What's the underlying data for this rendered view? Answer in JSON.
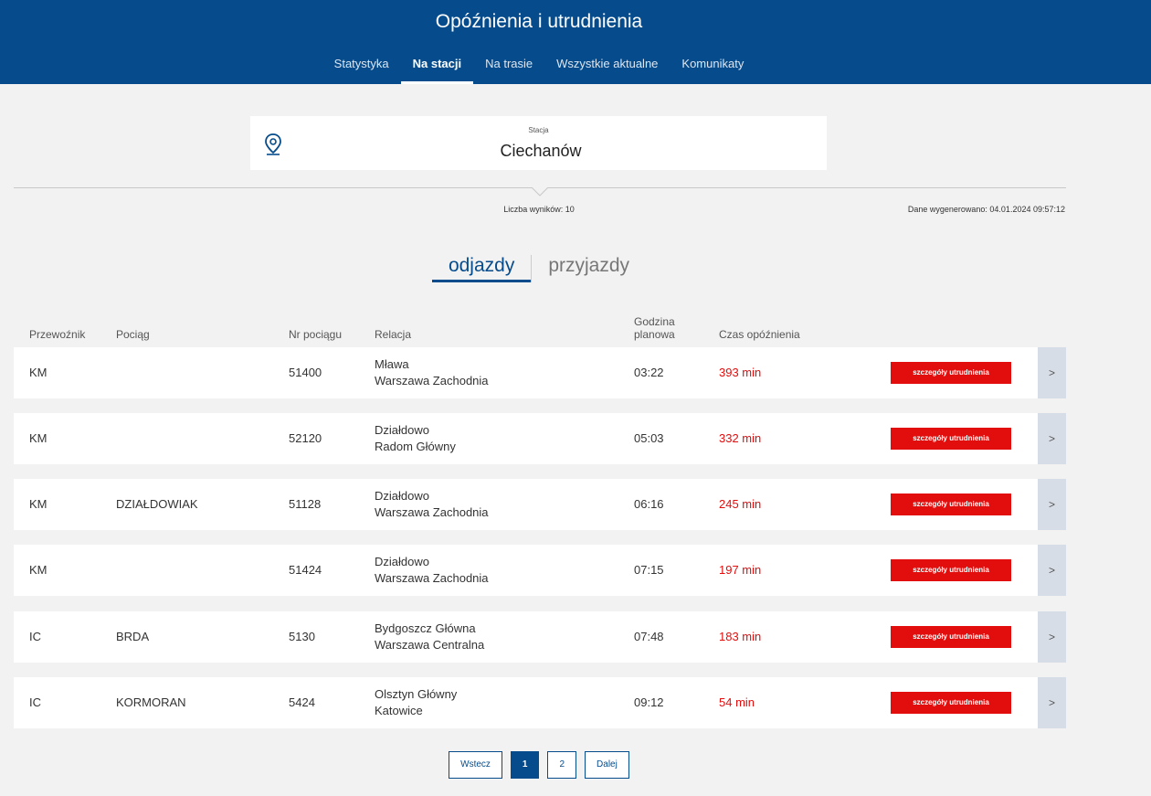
{
  "header": {
    "title": "Opóźnienia i utrudnienia",
    "nav": [
      {
        "label": "Statystyka",
        "active": false
      },
      {
        "label": "Na stacji",
        "active": true
      },
      {
        "label": "Na trasie",
        "active": false
      },
      {
        "label": "Wszystkie aktualne",
        "active": false
      },
      {
        "label": "Komunikaty",
        "active": false
      }
    ]
  },
  "station": {
    "label": "Stacja",
    "value": "Ciechanów",
    "icon": "map-pin-icon"
  },
  "info": {
    "results_count": "Liczba wyników: 10",
    "generated": "Dane wygenerowano: 04.01.2024 09:57:12"
  },
  "tabs": {
    "departures": "odjazdy",
    "arrivals": "przyjazdy",
    "active": "departures"
  },
  "table": {
    "headers": {
      "carrier": "Przewoźnik",
      "train": "Pociąg",
      "train_no": "Nr pociągu",
      "relation": "Relacja",
      "planned_line1": "Godzina",
      "planned_line2": "planowa",
      "delay": "Czas opóźnienia"
    },
    "details_label": "szczegóły utrudnienia",
    "expand_icon": "chevron-right-icon",
    "rows": [
      {
        "carrier": "KM",
        "train": "",
        "train_no": "51400",
        "from": "Mława",
        "to": "Warszawa Zachodnia",
        "planned": "03:22",
        "delay": "393 min"
      },
      {
        "carrier": "KM",
        "train": "",
        "train_no": "52120",
        "from": "Działdowo",
        "to": "Radom Główny",
        "planned": "05:03",
        "delay": "332 min"
      },
      {
        "carrier": "KM",
        "train": "DZIAŁDOWIAK",
        "train_no": "51128",
        "from": "Działdowo",
        "to": "Warszawa Zachodnia",
        "planned": "06:16",
        "delay": "245 min"
      },
      {
        "carrier": "KM",
        "train": "",
        "train_no": "51424",
        "from": "Działdowo",
        "to": "Warszawa Zachodnia",
        "planned": "07:15",
        "delay": "197 min"
      },
      {
        "carrier": "IC",
        "train": "BRDA",
        "train_no": "5130",
        "from": "Bydgoszcz Główna",
        "to": "Warszawa Centralna",
        "planned": "07:48",
        "delay": "183 min"
      },
      {
        "carrier": "IC",
        "train": "KORMORAN",
        "train_no": "5424",
        "from": "Olsztyn Główny",
        "to": "Katowice",
        "planned": "09:12",
        "delay": "54 min"
      }
    ]
  },
  "pagination": {
    "prev": "Wstecz",
    "pages": [
      "1",
      "2"
    ],
    "current": "1",
    "next": "Dalej"
  },
  "colors": {
    "brand": "#064c8c",
    "alert": "#e20d0d",
    "background": "#f2f2f2"
  }
}
